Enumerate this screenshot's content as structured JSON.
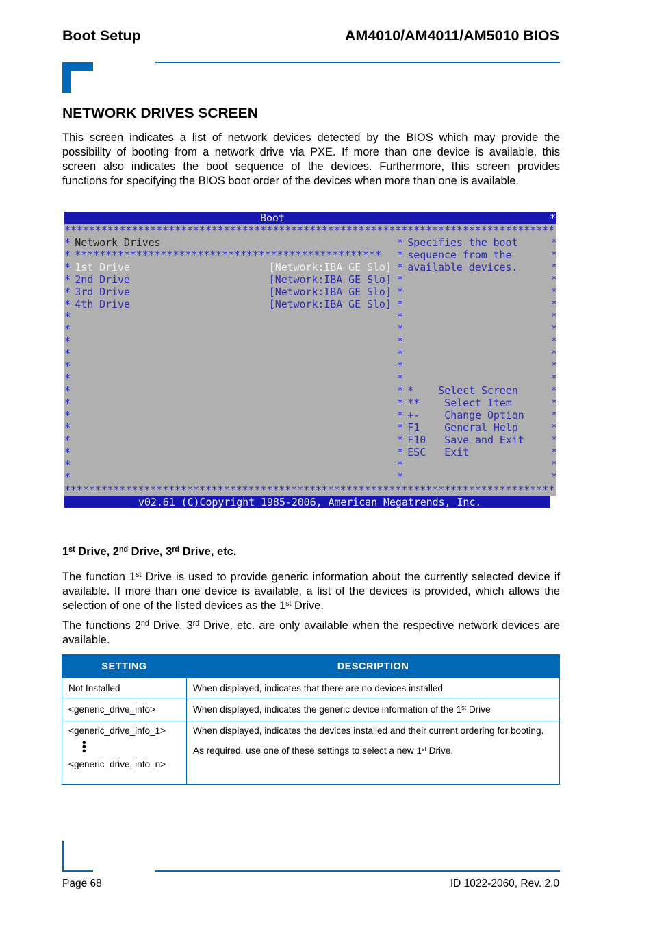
{
  "header": {
    "left_title": "Boot Setup",
    "right_title": "AM4010/AM4011/AM5010 BIOS"
  },
  "section": {
    "title": "NETWORK DRIVES SCREEN",
    "intro_lines": [
      "This screen indicates a list of network devices detected by the BIOS which may provide the",
      "possibility of booting from a network drive via PXE. If more than one device is available, this",
      "screen also indicates the boot sequence of the devices. Furthermore, this screen provides",
      "functions for specifying the BIOS boot order of the devices when more than one is available."
    ]
  },
  "bios": {
    "colors": {
      "background": "#b0b0b0",
      "bar": "#1818b0",
      "text": "#2c2cb0",
      "highlight": "#f0f0f0"
    },
    "title": "Boot",
    "star_line": "********************************************************************************",
    "inner_star_line": "**************************************************",
    "section_heading": "Network Drives",
    "drives": [
      {
        "label": "1st Drive",
        "value": "[Network:IBA GE Slo]",
        "selected": true
      },
      {
        "label": "2nd Drive",
        "value": "[Network:IBA GE Slo]",
        "selected": false
      },
      {
        "label": "3rd Drive",
        "value": "[Network:IBA GE Slo]",
        "selected": false
      },
      {
        "label": "4th Drive",
        "value": "[Network:IBA GE Slo]",
        "selected": false
      }
    ],
    "help_lines": [
      "Specifies the boot",
      "sequence from the",
      "available devices."
    ],
    "keys": [
      {
        "key": "*",
        "action": "Select Screen"
      },
      {
        "key": "**",
        "action": "Select Item"
      },
      {
        "key": "+-",
        "action": "Change Option"
      },
      {
        "key": "F1",
        "action": "General Help"
      },
      {
        "key": "F10",
        "action": "Save and Exit"
      },
      {
        "key": "ESC",
        "action": "Exit"
      }
    ],
    "footer": "v02.61 (C)Copyright 1985-2006, American Megatrends, Inc."
  },
  "subsection": {
    "title_parts": [
      "1",
      "st",
      " Drive, 2",
      "nd",
      " Drive, 3",
      "rd",
      " Drive, etc."
    ],
    "para1": {
      "a": "The function 1",
      "sup1": "st",
      "b": " Drive is used to provide generic information about the currently selected device if available. If more than one device is available, a list of the devices is provided, which allows the selection of one of the listed devices as the 1",
      "sup2": "st",
      "c": " Drive."
    },
    "para2": {
      "a": "The functions 2",
      "sup1": "nd",
      "b": " Drive, 3",
      "sup2": "rd",
      "c": " Drive, etc. are only available when the respective network devices are available."
    }
  },
  "table": {
    "headers": [
      "SETTING",
      "DESCRIPTION"
    ],
    "rows": [
      {
        "setting": "Not Installed",
        "description": "When displayed, indicates that there are no devices installed"
      },
      {
        "setting": "<generic_drive_info>",
        "description_a": "When displayed, indicates the generic device information of the 1",
        "description_sup": "st",
        "description_b": " Drive"
      },
      {
        "setting_first": "<generic_drive_info_1>",
        "setting_dots": "⋮",
        "setting_last": "<generic_drive_info_n>",
        "description_line1": "When displayed, indicates the devices installed and their current ordering for booting.",
        "description_line2_a": "As required, use one of these settings to select a new 1",
        "description_line2_sup": "st",
        "description_line2_b": " Drive."
      }
    ]
  },
  "footer": {
    "page": "Page 68",
    "doc_id": "ID 1022-2060, Rev. 2.0"
  }
}
